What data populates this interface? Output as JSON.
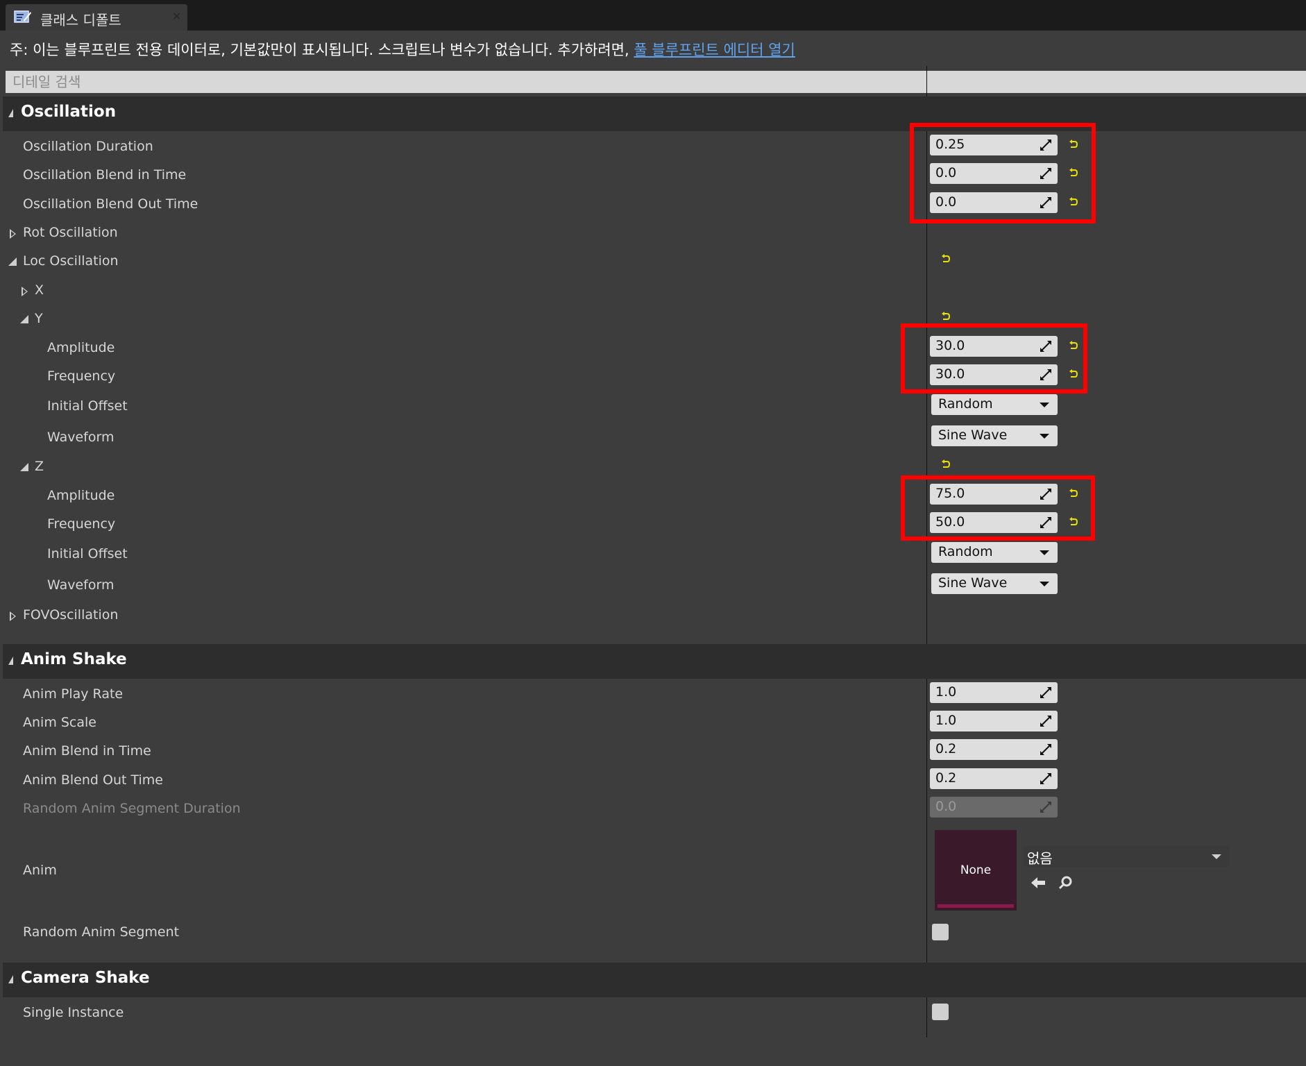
{
  "tab": {
    "title": "클래스 디폴트"
  },
  "note": {
    "text": "주: 이는 블루프린트 전용 데이터로, 기본값만이 표시됩니다. 스크립트나 변수가 없습니다. 추가하려면, ",
    "link": "풀 블루프린트 에디터 열기"
  },
  "search": {
    "placeholder": "디테일 검색"
  },
  "categories": {
    "oscillation": "Oscillation",
    "anim_shake": "Anim Shake",
    "camera_shake": "Camera Shake"
  },
  "oscillation": {
    "duration": {
      "label": "Oscillation Duration",
      "value": "0.25"
    },
    "blend_in": {
      "label": "Oscillation Blend in Time",
      "value": "0.0"
    },
    "blend_out": {
      "label": "Oscillation Blend Out Time",
      "value": "0.0"
    },
    "rot": {
      "label": "Rot Oscillation"
    },
    "loc": {
      "label": "Loc Oscillation"
    },
    "x": {
      "label": "X"
    },
    "y": {
      "label": "Y",
      "amplitude": {
        "label": "Amplitude",
        "value": "30.0"
      },
      "frequency": {
        "label": "Frequency",
        "value": "30.0"
      },
      "initial_offset": {
        "label": "Initial Offset",
        "value": "Random"
      },
      "waveform": {
        "label": "Waveform",
        "value": "Sine Wave"
      }
    },
    "z": {
      "label": "Z",
      "amplitude": {
        "label": "Amplitude",
        "value": "75.0"
      },
      "frequency": {
        "label": "Frequency",
        "value": "50.0"
      },
      "initial_offset": {
        "label": "Initial Offset",
        "value": "Random"
      },
      "waveform": {
        "label": "Waveform",
        "value": "Sine Wave"
      }
    },
    "fov": {
      "label": "FOVOscillation"
    }
  },
  "anim_shake": {
    "play_rate": {
      "label": "Anim Play Rate",
      "value": "1.0"
    },
    "scale": {
      "label": "Anim Scale",
      "value": "1.0"
    },
    "blend_in": {
      "label": "Anim Blend in Time",
      "value": "0.2"
    },
    "blend_out": {
      "label": "Anim Blend Out Time",
      "value": "0.2"
    },
    "random_duration": {
      "label": "Random Anim Segment Duration",
      "value": "0.0"
    },
    "anim": {
      "label": "Anim",
      "thumb": "None",
      "asset": "없음"
    },
    "random_segment": {
      "label": "Random Anim Segment",
      "checked": false
    }
  },
  "camera_shake": {
    "single_instance": {
      "label": "Single Instance",
      "checked": false
    }
  },
  "colors": {
    "highlight": "#ff0000",
    "reset_arrow": "#e8e000",
    "link": "#5fa3ee"
  }
}
